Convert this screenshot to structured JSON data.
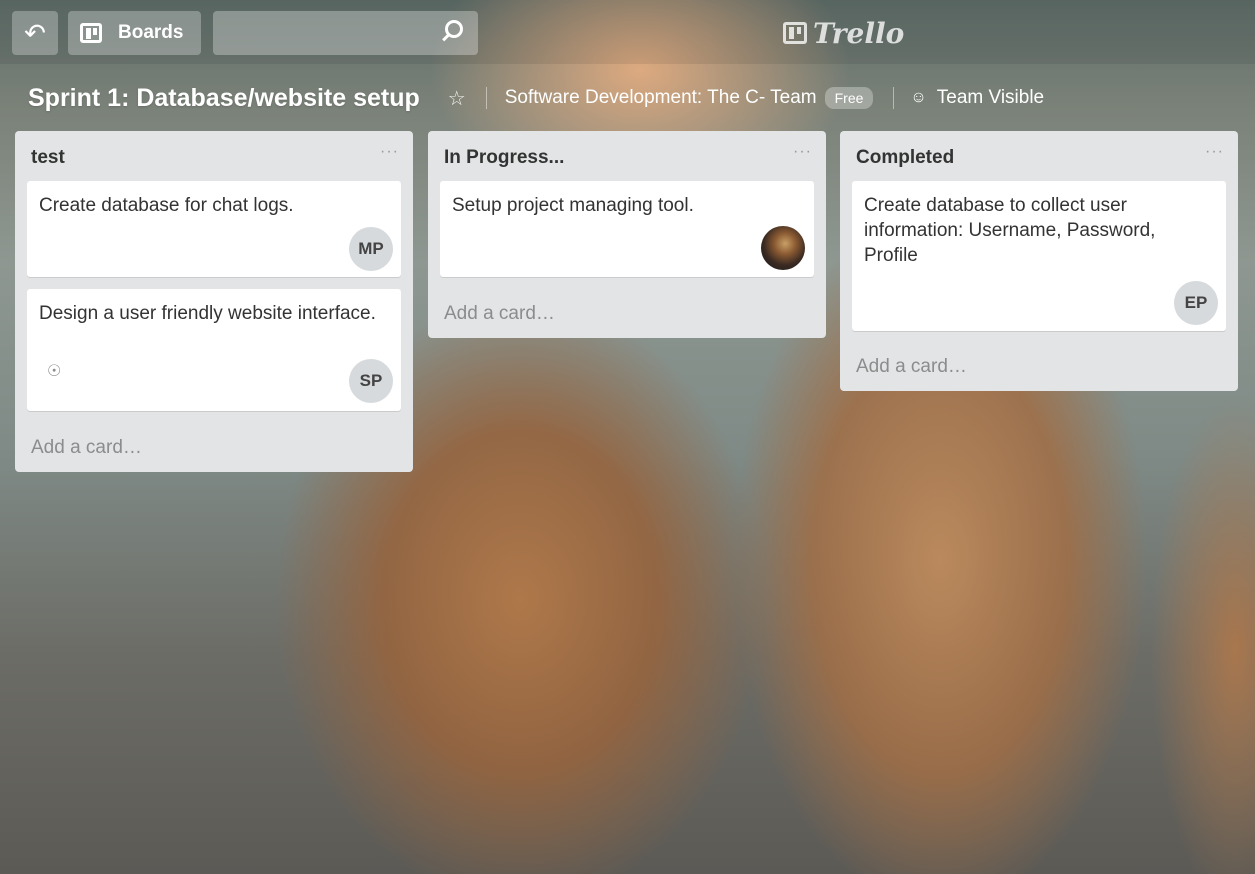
{
  "header": {
    "back_icon": "back-arrow-icon",
    "boards_label": "Boards",
    "search_placeholder": "",
    "logo_text": "Trello"
  },
  "board": {
    "title": "Sprint 1: Database/website setup",
    "star_icon": "star-icon",
    "team": "Software Development: The C- Team",
    "plan_badge": "Free",
    "visibility_icon": "team-icon",
    "visibility": "Team Visible"
  },
  "lists": [
    {
      "title": "test",
      "menu": "···",
      "cards": [
        {
          "text": "Create database for chat logs.",
          "member": "MP"
        },
        {
          "text": "Design a user friendly website interface.",
          "member": "SP",
          "watch_icon": "eye-icon"
        }
      ],
      "add_card": "Add a card…"
    },
    {
      "title": "In Progress...",
      "menu": "···",
      "cards": [
        {
          "text": "Setup project managing tool.",
          "member_avatar": "photo"
        }
      ],
      "add_card": "Add a card…"
    },
    {
      "title": "Completed",
      "menu": "···",
      "cards": [
        {
          "text": "Create database to collect user information: Username, Password, Profile",
          "member": "EP"
        }
      ],
      "add_card": "Add a card…"
    }
  ]
}
